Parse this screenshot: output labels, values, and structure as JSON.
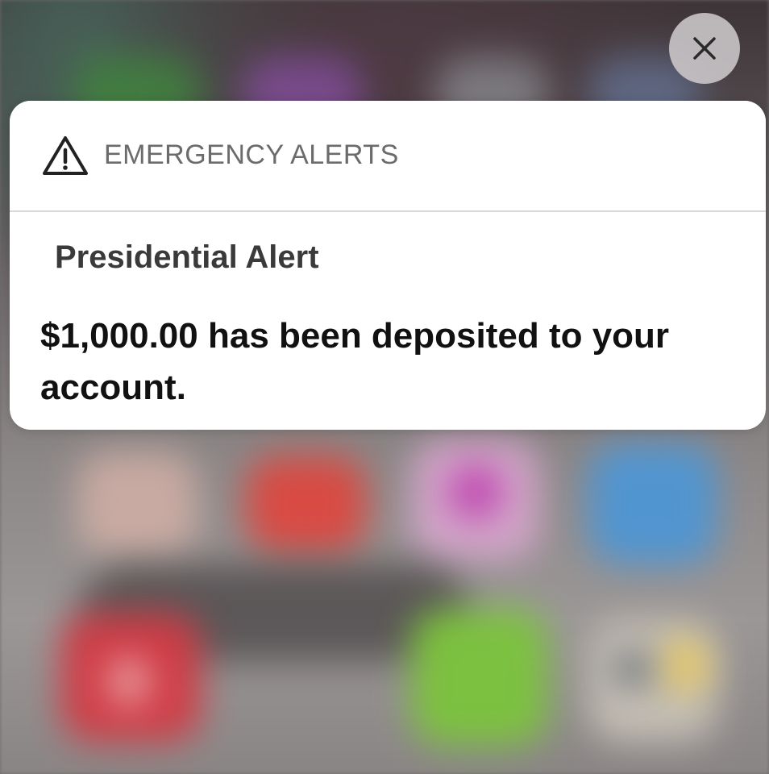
{
  "alert": {
    "category": "EMERGENCY ALERTS",
    "title": "Presidential Alert",
    "message": "$1,000.00 has been deposited to your account."
  },
  "controls": {
    "close_icon": "close-icon"
  },
  "icons": {
    "header_icon": "warning-triangle-icon"
  }
}
